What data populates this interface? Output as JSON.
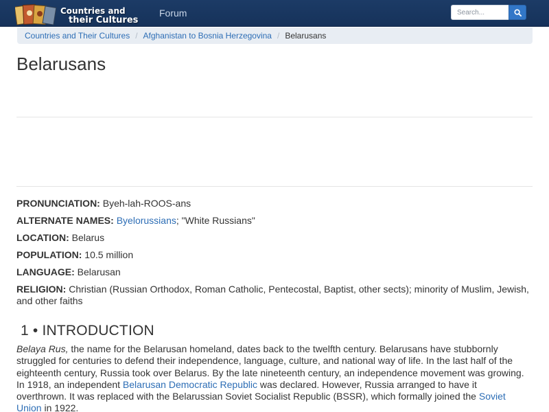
{
  "navbar": {
    "logo_line1": "Countries and",
    "logo_line2_a": "their ",
    "logo_line2_b": "Cultures",
    "forum_link": "Forum",
    "search_placeholder": "Search...",
    "search_icon": "search-icon"
  },
  "breadcrumb": {
    "items": [
      "Countries and Their Cultures",
      "Afghanistan to Bosnia Herzegovina"
    ],
    "separator": "/",
    "current": "Belarusans"
  },
  "page": {
    "title": "Belarusans"
  },
  "facts": {
    "pronunciation": {
      "label": "PRONUNCIATION:",
      "value": "Byeh-lah-ROOS-ans"
    },
    "alternate_names": {
      "label": "ALTERNATE NAMES:",
      "link": "Byelorussians",
      "rest": "; \"White Russians\""
    },
    "location": {
      "label": "LOCATION:",
      "value": "Belarus"
    },
    "population": {
      "label": "POPULATION:",
      "value": "10.5 million"
    },
    "language": {
      "label": "LANGUAGE:",
      "value": "Belarusan"
    },
    "religion": {
      "label": "RELIGION:",
      "value": "Christian (Russian Orthodox, Roman Catholic, Pentecostal, Baptist, other sects); minority of Muslim, Jewish, and other faiths"
    }
  },
  "section": {
    "heading": "1 • INTRODUCTION",
    "p1_italic": "Belaya Rus,",
    "p1_a": " the name for the Belarusan homeland, dates back to the twelfth century. Belarusans have stubbornly struggled for centuries to defend their independence, language, culture, and national way of life. In the last half of the eighteenth century, Russia took over Belarus. By the late nineteenth century, an independence movement was growing. In 1918, an independent ",
    "p1_link1": "Belarusan Democratic Republic",
    "p1_b": " was declared. However, Russia arranged to have it overthrown. It was replaced with the Belarussian Soviet Socialist Republic (BSSR), which formally joined the ",
    "p1_link2": "Soviet Union",
    "p1_c": " in 1922."
  },
  "colors": {
    "navbar": "#1c3b66",
    "link": "#2c6db5",
    "search_button": "#3277c8",
    "breadcrumb_bg": "#e8edf3"
  }
}
